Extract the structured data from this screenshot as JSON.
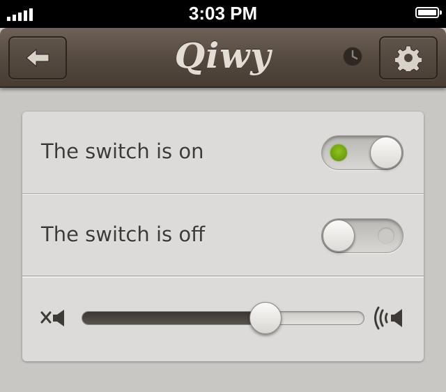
{
  "status_bar": {
    "time": "3:03 PM",
    "signal_bars": 5,
    "battery_level": 1.0
  },
  "nav": {
    "title": "Qiwy",
    "back_icon": "arrow-left-icon",
    "history_icon": "clock-icon",
    "settings_icon": "gear-icon"
  },
  "settings": {
    "rows": [
      {
        "label": "The switch is on",
        "switch_on": true
      },
      {
        "label": "The switch is off",
        "switch_on": false
      }
    ],
    "volume": {
      "low_icon": "mute-speaker-icon",
      "high_icon": "loud-speaker-icon",
      "level": 0.65
    }
  },
  "colors": {
    "nav_brown": "#54493f",
    "switch_on_led": "#7fb315",
    "panel_bg": "#dcdbd9",
    "page_bg": "#c9c7c4",
    "label_text": "#3e3a36"
  }
}
